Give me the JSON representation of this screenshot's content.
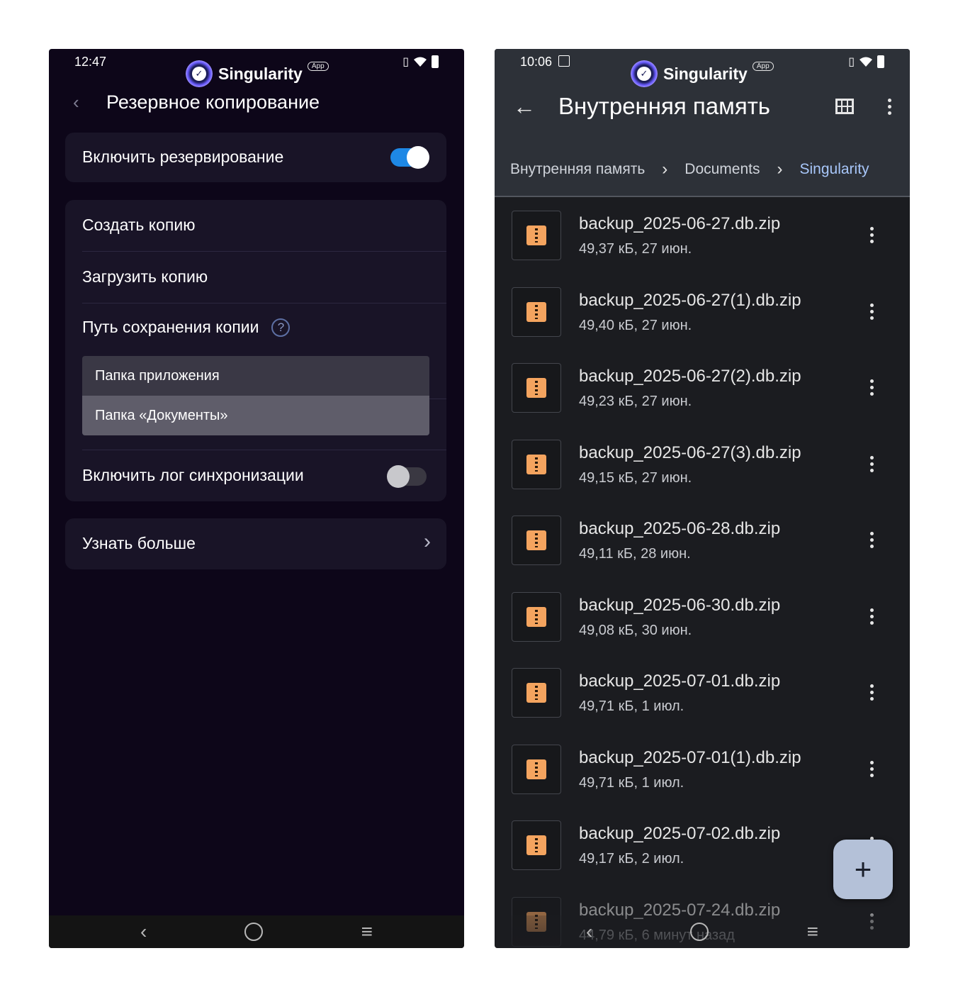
{
  "left": {
    "status_time": "12:47",
    "brand_name": "Singularity",
    "brand_badge": "App",
    "title": "Резервное копирование",
    "enable_backup_label": "Включить резервирование",
    "enable_backup_on": true,
    "create_copy_label": "Создать копию",
    "load_copy_label": "Загрузить копию",
    "save_path_label": "Путь сохранения копии",
    "help_glyph": "?",
    "path_options": [
      "Папка приложения",
      "Папка «Документы»"
    ],
    "path_selected_index": 1,
    "sync_log_label": "Включить лог синхронизации",
    "sync_log_on": false,
    "learn_more_label": "Узнать больше"
  },
  "right": {
    "status_time": "10:06",
    "brand_name": "Singularity",
    "brand_badge": "App",
    "title": "Внутренняя память",
    "breadcrumbs": [
      "Внутренняя память",
      "Documents",
      "Singularity"
    ],
    "files": [
      {
        "name": "backup_2025-06-27.db.zip",
        "meta": "49,37 кБ, 27 июн."
      },
      {
        "name": "backup_2025-06-27(1).db.zip",
        "meta": "49,40 кБ, 27 июн."
      },
      {
        "name": "backup_2025-06-27(2).db.zip",
        "meta": "49,23 кБ, 27 июн."
      },
      {
        "name": "backup_2025-06-27(3).db.zip",
        "meta": "49,15 кБ, 27 июн."
      },
      {
        "name": "backup_2025-06-28.db.zip",
        "meta": "49,11 кБ, 28 июн."
      },
      {
        "name": "backup_2025-06-30.db.zip",
        "meta": "49,08 кБ, 30 июн."
      },
      {
        "name": "backup_2025-07-01.db.zip",
        "meta": "49,71 кБ, 1 июл."
      },
      {
        "name": "backup_2025-07-01(1).db.zip",
        "meta": "49,71 кБ, 1 июл."
      },
      {
        "name": "backup_2025-07-02.db.zip",
        "meta": "49,17 кБ, 2 июл."
      },
      {
        "name": "backup_2025-07-24.db.zip",
        "meta": "44,79 кБ, 6 минут назад"
      }
    ],
    "fab_glyph": "+"
  },
  "colors": {
    "left_bg": "#0d0619",
    "card_bg": "#191427",
    "toggle_on": "#1e88e5",
    "right_bg": "#1b1c20",
    "zip_orange": "#f4a45f",
    "breadcrumb_active": "#a8c7fa"
  }
}
